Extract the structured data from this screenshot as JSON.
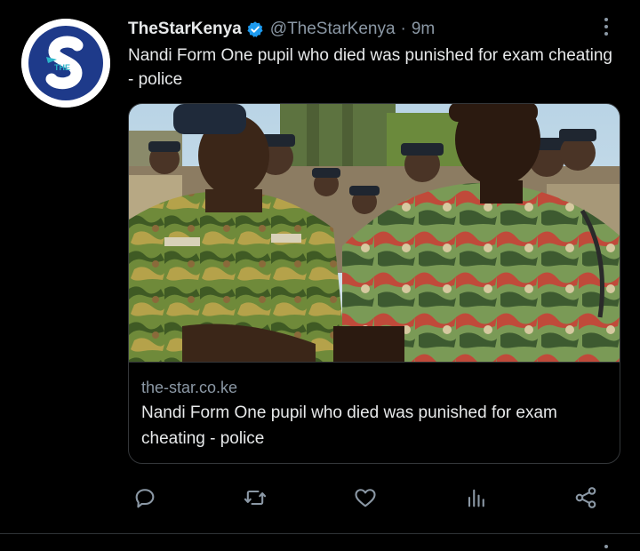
{
  "tweet": {
    "display_name": "TheStarKenya",
    "handle": "@TheStarKenya",
    "separator": "·",
    "time": "9m",
    "text": "Nandi Form One pupil who died was punished for exam cheating - police",
    "avatar": {
      "letter": "S",
      "small_text": "THE",
      "color": "#1e3a8a",
      "accent": "#2bb5c9"
    },
    "verified_color": "#1d9bf0"
  },
  "card": {
    "domain": "the-star.co.ke",
    "title": "Nandi Form One pupil who died was punished for exam cheating - police",
    "image_description_icon": "news-photo"
  },
  "actions": {
    "reply": "reply-icon",
    "retweet": "retweet-icon",
    "like": "heart-icon",
    "views": "views-icon",
    "share": "share-icon"
  },
  "colors": {
    "background": "#000000",
    "text": "#e7e9ea",
    "muted": "#8b98a5",
    "border": "#333639"
  }
}
